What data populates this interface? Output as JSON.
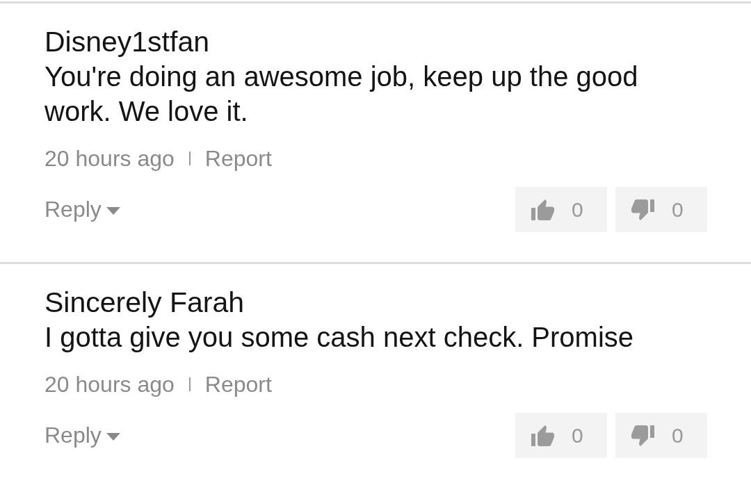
{
  "comments": [
    {
      "author": "Disney1stfan",
      "text": "You're doing an awesome job, keep up the good work. We love it.",
      "time": "20 hours ago",
      "report": "Report",
      "reply": "Reply",
      "likes": "0",
      "dislikes": "0"
    },
    {
      "author": "Sincerely Farah",
      "text": "I gotta give you some cash next check. Promise",
      "time": "20 hours ago",
      "report": "Report",
      "reply": "Reply",
      "likes": "0",
      "dislikes": "0"
    }
  ]
}
